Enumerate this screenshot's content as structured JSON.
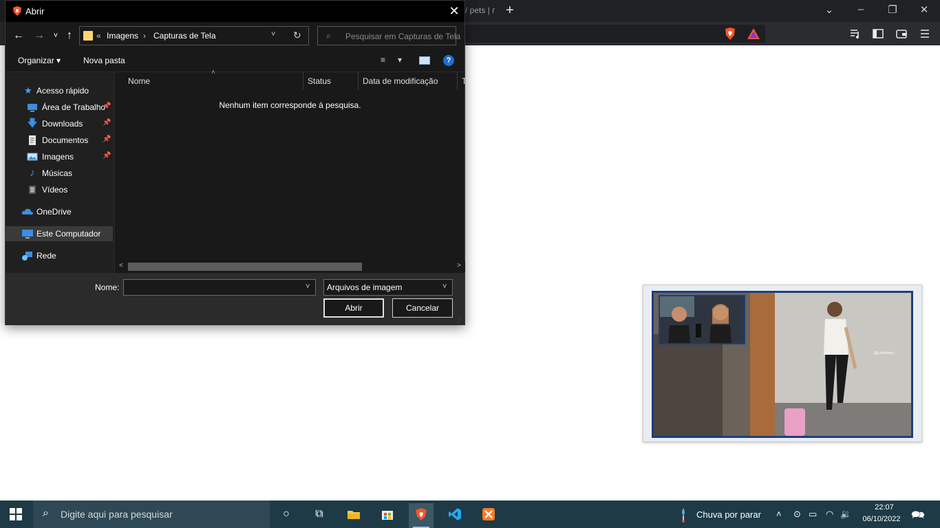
{
  "browser": {
    "tab_fragment": "/ pets | г",
    "new_tab": "+",
    "window_controls": {
      "chevron": "⌄",
      "minimize": "–",
      "restore": "❐",
      "close": "✕"
    },
    "toolbar_icons": [
      "playlist-icon",
      "sidebar-icon",
      "wallet-icon",
      "menu-icon"
    ]
  },
  "dialog": {
    "title": "Abrir",
    "close": "✕",
    "nav": {
      "back": "←",
      "forward": "→",
      "recent": "˅",
      "up": "↑"
    },
    "address": {
      "overflow": "«",
      "crumbs": [
        "Imagens",
        "Capturas de Tela"
      ],
      "separator": "›",
      "dropdown": "˅",
      "refresh": "↻"
    },
    "search": {
      "placeholder": "Pesquisar em Capturas de Tela",
      "icon": "⌕"
    },
    "commands": {
      "organize": "Organizar",
      "organize_arrow": "▾",
      "new_folder": "Nova pasta",
      "view_icon": "≡",
      "view_arrow": "▾",
      "help": "?"
    },
    "navpane": {
      "items": [
        {
          "label": "Acesso rápido",
          "icon": "star-icon",
          "pinned": false
        },
        {
          "label": "Área de Trabalho",
          "icon": "desktop-icon",
          "pinned": true
        },
        {
          "label": "Downloads",
          "icon": "download-icon",
          "pinned": true
        },
        {
          "label": "Documentos",
          "icon": "document-icon",
          "pinned": true
        },
        {
          "label": "Imagens",
          "icon": "pictures-icon",
          "pinned": true
        },
        {
          "label": "Músicas",
          "icon": "music-icon",
          "pinned": false
        },
        {
          "label": "Vídeos",
          "icon": "video-icon",
          "pinned": false
        },
        {
          "label": "OneDrive",
          "icon": "cloud-icon",
          "pinned": false
        },
        {
          "label": "Este Computador",
          "icon": "computer-icon",
          "pinned": false,
          "selected": true
        },
        {
          "label": "Rede",
          "icon": "network-icon",
          "pinned": false
        }
      ],
      "pin_glyph": "📌"
    },
    "columns": [
      "Nome",
      "Status",
      "Data de modificação",
      "T"
    ],
    "sort_glyph": "˄",
    "empty_message": "Nenhum item corresponde à pesquisa.",
    "scroll": {
      "left": "<",
      "right": ">"
    },
    "filename_label": "Nome:",
    "filename_value": "",
    "dropdown_glyph": "˅",
    "filter": "Arquivos de imagem",
    "open_button": "Abrir",
    "cancel_button": "Cancelar",
    "grip": "⋰"
  },
  "pip": {
    "watermark": "@Leila.filhos"
  },
  "taskbar": {
    "search_placeholder": "Digite aqui para pesquisar",
    "search_icon": "⌕",
    "apps": [
      "cortana-icon",
      "task-view-icon",
      "file-explorer-icon",
      "store-icon",
      "brave-icon",
      "vscode-icon",
      "xampp-icon"
    ],
    "cortana_glyph": "○",
    "task_view_glyph": "⧉",
    "weather": "Chuva por parar",
    "tray": {
      "chevron": "˄",
      "meet": "⊙",
      "battery": "▭",
      "wifi": "◠",
      "volume": "🔉"
    },
    "time": "22:07",
    "date": "06/10/2022",
    "notification": "🗪"
  },
  "colors": {
    "accent": "#1e6fd0",
    "taskbar": "#1e3a47",
    "brave_orange": "#fb542b",
    "folder": "#f8d775"
  }
}
